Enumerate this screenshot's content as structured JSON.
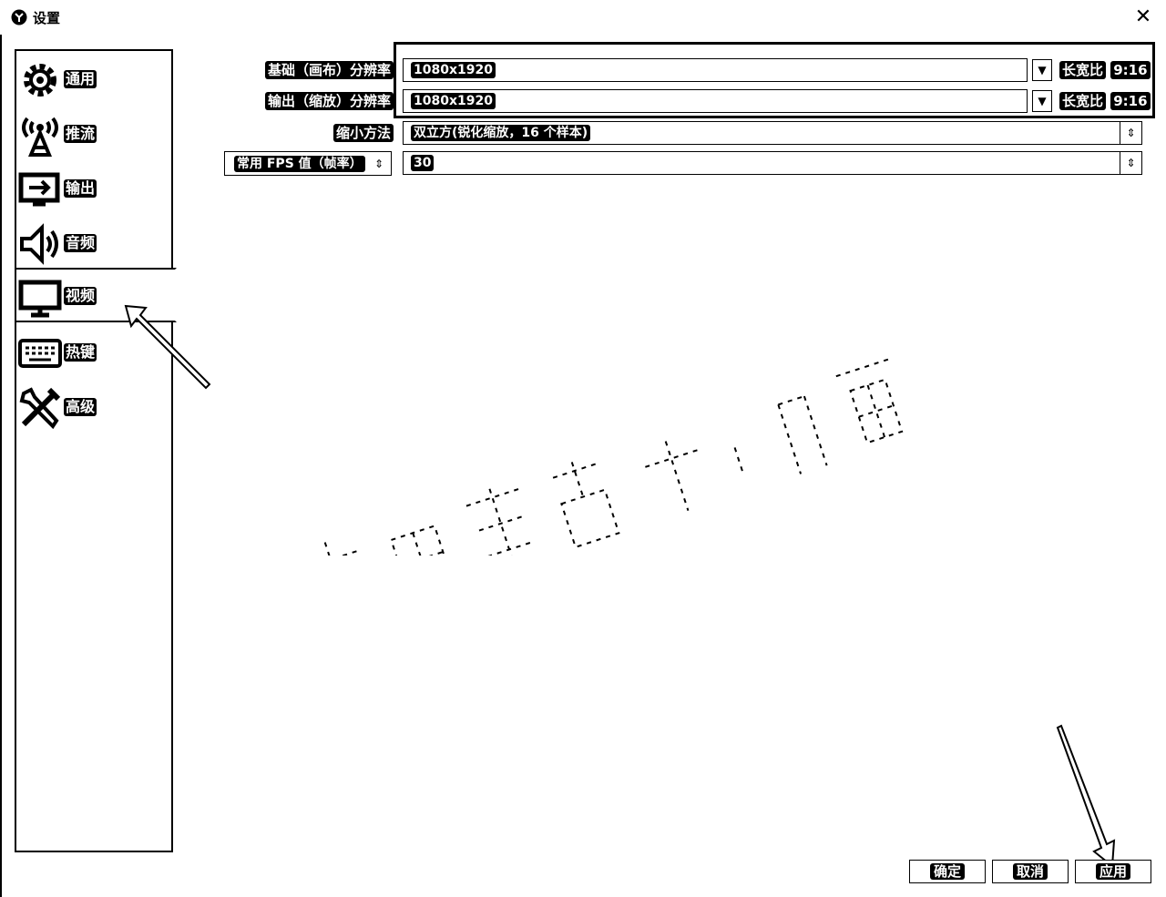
{
  "window": {
    "title": "设置",
    "close_icon": "close-icon"
  },
  "sidebar": {
    "items": [
      {
        "label": "通用",
        "icon": "gear-icon"
      },
      {
        "label": "推流",
        "icon": "broadcast-icon"
      },
      {
        "label": "输出",
        "icon": "output-icon"
      },
      {
        "label": "音频",
        "icon": "speaker-icon"
      },
      {
        "label": "视频",
        "icon": "monitor-icon",
        "selected": true
      },
      {
        "label": "热键",
        "icon": "keyboard-icon"
      },
      {
        "label": "高级",
        "icon": "tools-icon"
      }
    ]
  },
  "video": {
    "base_resolution": {
      "label": "基础（画布）分辨率",
      "value": "1080x1920",
      "aspect_label": "长宽比",
      "aspect_value": "9:16"
    },
    "output_resolution": {
      "label": "输出（缩放）分辨率",
      "value": "1080x1920",
      "aspect_label": "长宽比",
      "aspect_value": "9:16"
    },
    "downscale_filter": {
      "label": "缩小方法",
      "value": "双立方(锐化缩放，16 个样本)"
    },
    "fps": {
      "label": "常用 FPS 值（帧率）",
      "value": "30"
    }
  },
  "footer": {
    "ok_label": "确定",
    "cancel_label": "取消",
    "apply_label": "应用"
  }
}
